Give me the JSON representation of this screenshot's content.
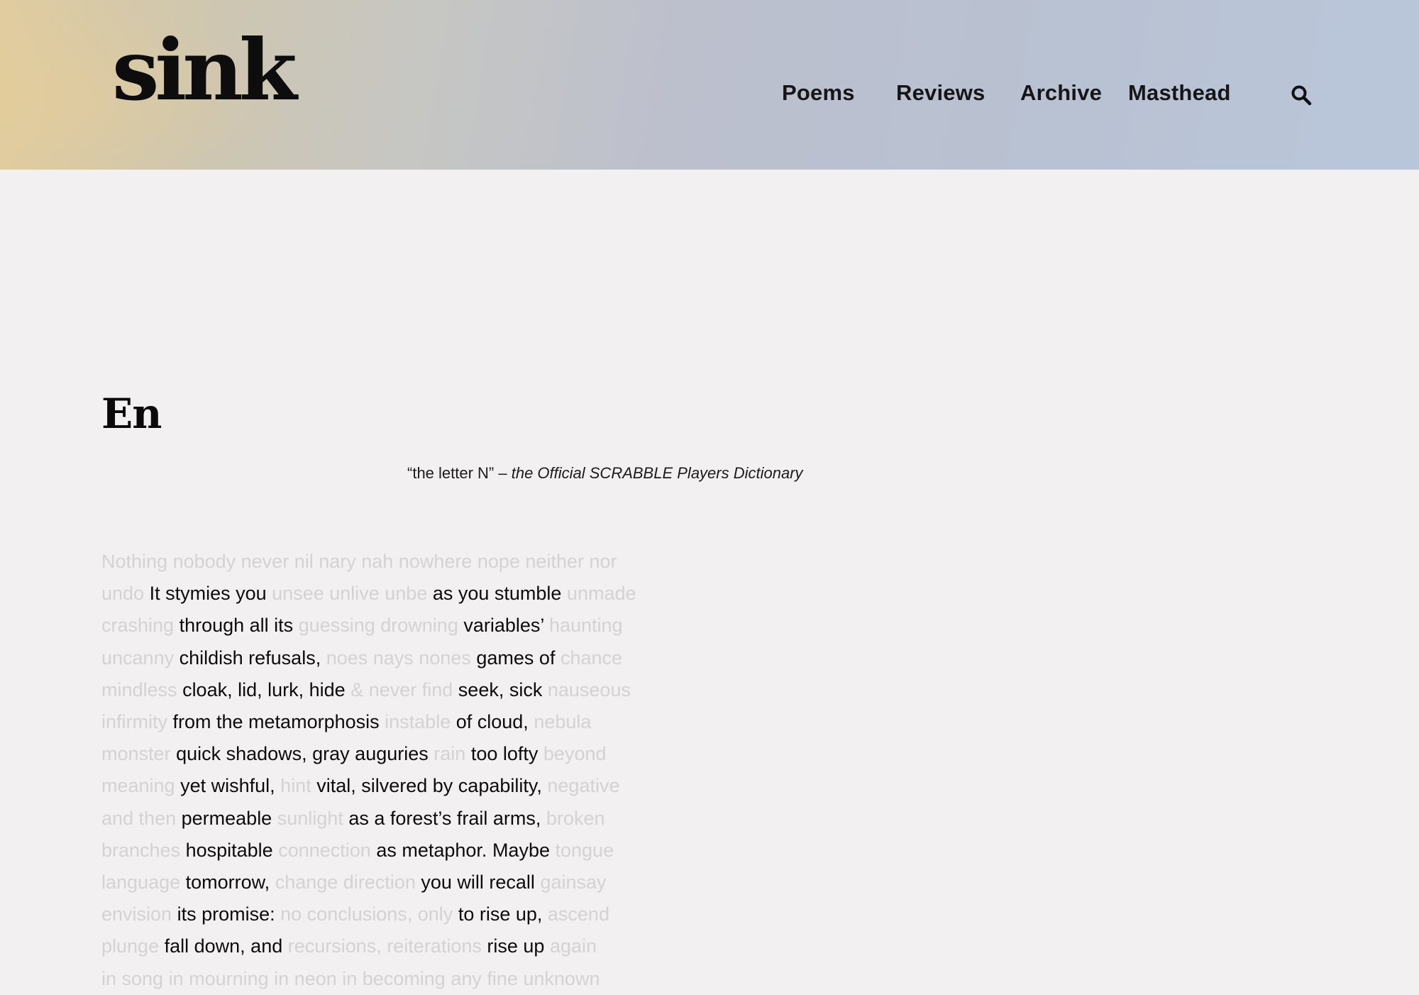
{
  "header": {
    "logo": "sink",
    "nav": [
      {
        "label": "Poems"
      },
      {
        "label": "Reviews"
      },
      {
        "label": "Archive"
      },
      {
        "label": "Masthead"
      }
    ],
    "search_icon": "search-icon"
  },
  "colors": {
    "gradient_start": "#e0cc9f",
    "gradient_mid": "#c6c6c3",
    "gradient_end": "#b9c6da",
    "page_background": "#f3f0f1",
    "ghost_text": "#d6d2d4",
    "visible_text": "#0c0c0c"
  },
  "poem": {
    "title": "En",
    "epigraph": {
      "quote": "“the letter N” – ",
      "source": "the Official SCRABBLE Players Dictionary"
    },
    "lines": [
      [
        {
          "t": "Nothing nobody never nil nary nah nowhere nope neither nor",
          "v": false
        }
      ],
      [
        {
          "t": "undo",
          "v": false
        },
        {
          "t": "It stymies you",
          "v": true
        },
        {
          "t": "unsee unlive unbe",
          "v": false
        },
        {
          "t": "as you stumble",
          "v": true
        },
        {
          "t": "unmade",
          "v": false
        }
      ],
      [
        {
          "t": "crashing",
          "v": false
        },
        {
          "t": "through all its",
          "v": true
        },
        {
          "t": "guessing drowning",
          "v": false
        },
        {
          "t": "variables’",
          "v": true
        },
        {
          "t": "haunting",
          "v": false
        }
      ],
      [
        {
          "t": "uncanny",
          "v": false
        },
        {
          "t": "childish refusals,",
          "v": true
        },
        {
          "t": "noes nays nones",
          "v": false
        },
        {
          "t": "games of",
          "v": true
        },
        {
          "t": "chance",
          "v": false
        }
      ],
      [
        {
          "t": "mindless",
          "v": false
        },
        {
          "t": "cloak, lid, lurk, hide",
          "v": true
        },
        {
          "t": "& never find",
          "v": false
        },
        {
          "t": "seek, sick",
          "v": true
        },
        {
          "t": "nauseous",
          "v": false
        }
      ],
      [
        {
          "t": "infirmity",
          "v": false
        },
        {
          "t": "from the metamorphosis",
          "v": true
        },
        {
          "t": "instable",
          "v": false
        },
        {
          "t": "of cloud,",
          "v": true
        },
        {
          "t": "nebula",
          "v": false
        }
      ],
      [
        {
          "t": "monster",
          "v": false
        },
        {
          "t": "quick shadows, gray auguries",
          "v": true
        },
        {
          "t": "rain",
          "v": false
        },
        {
          "t": "too lofty",
          "v": true
        },
        {
          "t": "beyond",
          "v": false
        }
      ],
      [
        {
          "t": "meaning",
          "v": false
        },
        {
          "t": "yet wishful,",
          "v": true
        },
        {
          "t": "hint",
          "v": false
        },
        {
          "t": "vital, silvered by capability,",
          "v": true
        },
        {
          "t": "negative",
          "v": false
        }
      ],
      [
        {
          "t": "and then",
          "v": false
        },
        {
          "t": "permeable",
          "v": true
        },
        {
          "t": "sunlight",
          "v": false
        },
        {
          "t": "as a forest’s frail arms,",
          "v": true
        },
        {
          "t": "broken",
          "v": false
        }
      ],
      [
        {
          "t": "branches",
          "v": false
        },
        {
          "t": "hospitable",
          "v": true
        },
        {
          "t": "connection",
          "v": false
        },
        {
          "t": "as metaphor. Maybe",
          "v": true
        },
        {
          "t": "tongue",
          "v": false
        }
      ],
      [
        {
          "t": "language",
          "v": false
        },
        {
          "t": "tomorrow,",
          "v": true
        },
        {
          "t": "change direction",
          "v": false
        },
        {
          "t": "you will recall",
          "v": true
        },
        {
          "t": "gainsay",
          "v": false
        }
      ],
      [
        {
          "t": "envision",
          "v": false
        },
        {
          "t": "its promise:",
          "v": true
        },
        {
          "t": "no conclusions, only",
          "v": false
        },
        {
          "t": "to rise up,",
          "v": true
        },
        {
          "t": "ascend",
          "v": false
        }
      ],
      [
        {
          "t": "plunge",
          "v": false
        },
        {
          "t": "fall down, and",
          "v": true
        },
        {
          "t": "recursions, reiterations",
          "v": false
        },
        {
          "t": "rise up",
          "v": true
        },
        {
          "t": "again",
          "v": false
        }
      ],
      [
        {
          "t": "in song in mourning in neon in becoming any fine unknown",
          "v": false
        }
      ]
    ]
  }
}
